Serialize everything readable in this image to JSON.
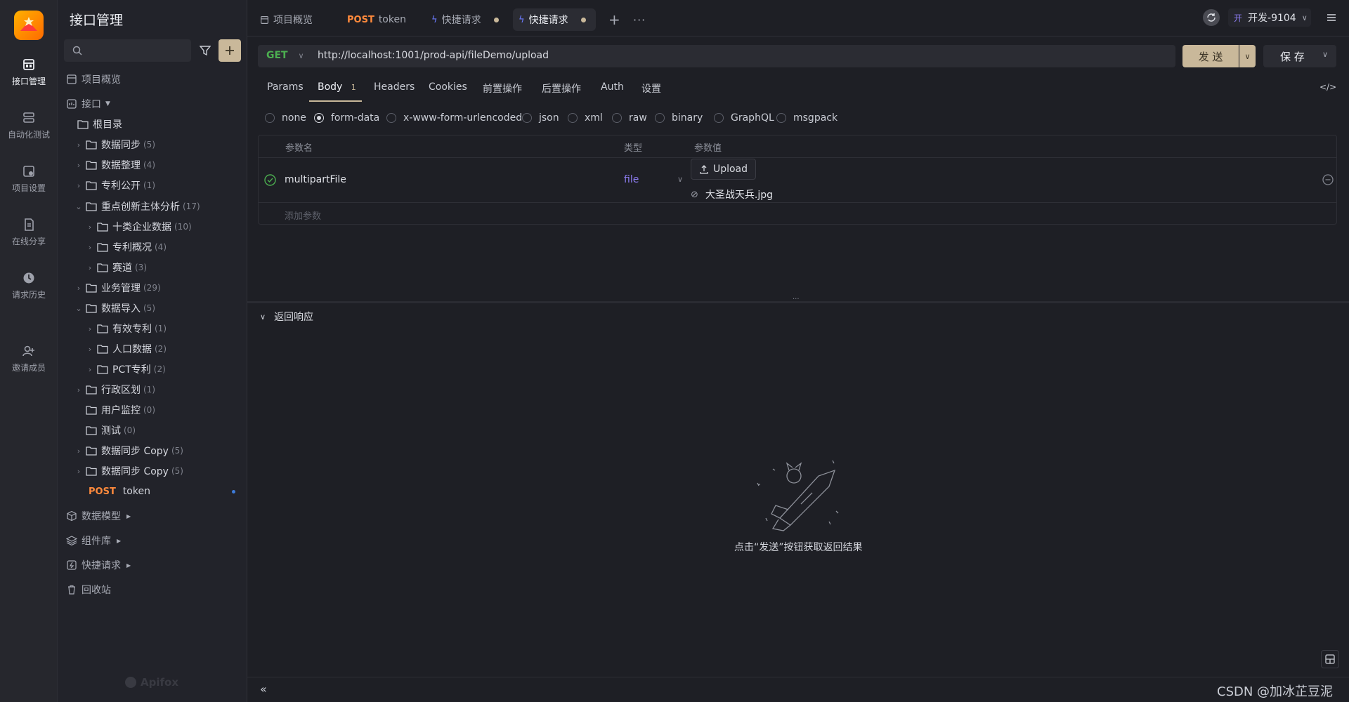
{
  "rail": {
    "items": [
      {
        "label": "接口管理",
        "icon": "api-icon"
      },
      {
        "label": "自动化测试",
        "icon": "automation-icon"
      },
      {
        "label": "项目设置",
        "icon": "project-settings-icon"
      },
      {
        "label": "在线分享",
        "icon": "share-icon"
      },
      {
        "label": "请求历史",
        "icon": "history-icon"
      },
      {
        "label": "邀请成员",
        "icon": "invite-member-icon"
      }
    ]
  },
  "tree": {
    "title": "接口管理",
    "overview": "项目概览",
    "api_section": "接口",
    "root": "根目录",
    "folders": [
      {
        "label": "数据同步",
        "count": "(5)"
      },
      {
        "label": "数据整理",
        "count": "(4)"
      },
      {
        "label": "专利公开",
        "count": "(1)"
      },
      {
        "label": "重点创新主体分析",
        "count": "(17)"
      },
      {
        "label": "十类企业数据",
        "count": "(10)"
      },
      {
        "label": "专利概况",
        "count": "(4)"
      },
      {
        "label": "赛道",
        "count": "(3)"
      },
      {
        "label": "业务管理",
        "count": "(29)"
      },
      {
        "label": "数据导入",
        "count": "(5)"
      },
      {
        "label": "有效专利",
        "count": "(1)"
      },
      {
        "label": "人口数据",
        "count": "(2)"
      },
      {
        "label": "PCT专利",
        "count": "(2)"
      },
      {
        "label": "行政区划",
        "count": "(1)"
      },
      {
        "label": "用户监控",
        "count": "(0)"
      },
      {
        "label": "测试",
        "count": "(0)"
      },
      {
        "label": "数据同步 Copy",
        "count": "(5)"
      },
      {
        "label": "数据同步 Copy",
        "count": "(5)"
      }
    ],
    "post_item": {
      "method": "POST",
      "label": "token"
    },
    "sections": [
      "数据模型",
      "组件库",
      "快捷请求",
      "回收站"
    ]
  },
  "tabs": {
    "items": [
      {
        "label": "项目概览"
      },
      {
        "method": "POST",
        "label": "token"
      },
      {
        "label": "快捷请求"
      },
      {
        "label": "快捷请求"
      }
    ],
    "env_prefix": "开",
    "env": "开发-9104"
  },
  "request": {
    "method": "GET",
    "url": "http://localhost:1001/prod-api/fileDemo/upload",
    "send": "发 送",
    "save": "保 存"
  },
  "subtabs": {
    "params": "Params",
    "body": "Body",
    "body_badge": "1",
    "headers": "Headers",
    "cookies": "Cookies",
    "pre": "前置操作",
    "post": "后置操作",
    "auth": "Auth",
    "settings": "设置"
  },
  "body_types": [
    "none",
    "form-data",
    "x-www-form-urlencoded",
    "json",
    "xml",
    "raw",
    "binary",
    "GraphQL",
    "msgpack"
  ],
  "body_type_selected": "form-data",
  "params_table": {
    "headers": {
      "name": "参数名",
      "type": "类型",
      "value": "参数值"
    },
    "rows": [
      {
        "name": "multipartFile",
        "type": "file",
        "upload": "Upload",
        "file": "大圣战天兵.jpg"
      }
    ],
    "add_placeholder": "添加参数"
  },
  "response": {
    "title": "返回响应",
    "empty_text": "点击“发送”按钮获取返回结果"
  },
  "footer": {
    "watermark": "CSDN @加冰芷豆泥",
    "brand": "Apifox"
  },
  "colors": {
    "accent": "#c9b89a",
    "get": "#4caf50",
    "post": "#ff8a3c",
    "file_type": "#8c7cf0"
  }
}
